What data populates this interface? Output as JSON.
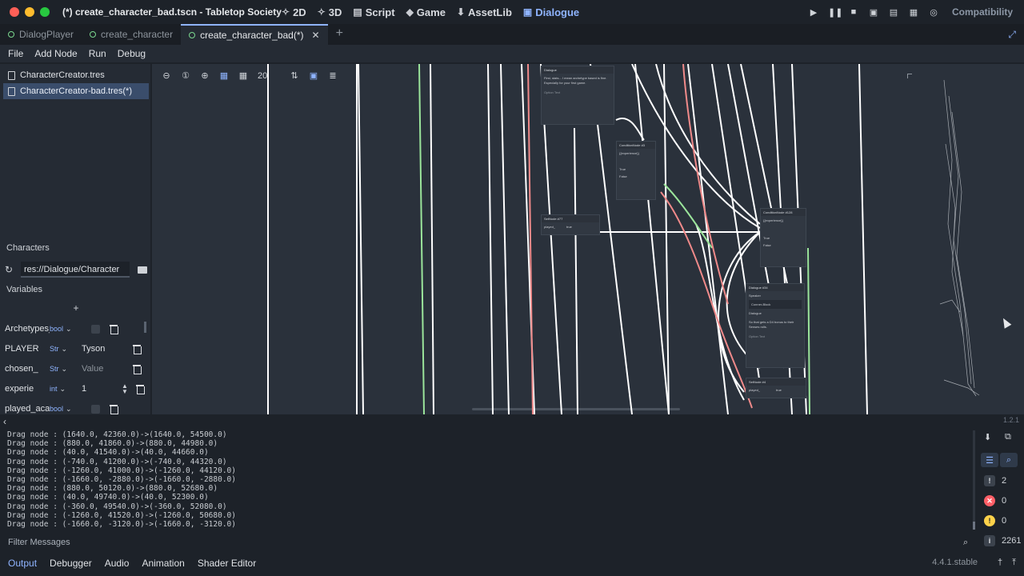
{
  "window": {
    "title": "(*) create_character_bad.tscn - Tabletop Society",
    "renderer": "Compatibility"
  },
  "main_modes": [
    {
      "label": "2D",
      "icon": "2d-icon"
    },
    {
      "label": "3D",
      "icon": "3d-icon"
    },
    {
      "label": "Script",
      "icon": "script-icon"
    },
    {
      "label": "Game",
      "icon": "game-icon"
    },
    {
      "label": "AssetLib",
      "icon": "assetlib-icon"
    },
    {
      "label": "Dialogue",
      "icon": "dialogue-icon",
      "active": true
    }
  ],
  "scene_tabs": [
    {
      "label": "DialogPlayer"
    },
    {
      "label": "create_character"
    },
    {
      "label": "create_character_bad(*)",
      "active": true
    }
  ],
  "menu": [
    "File",
    "Add Node",
    "Run",
    "Debug"
  ],
  "files": [
    {
      "label": "CharacterCreator.tres"
    },
    {
      "label": "CharacterCreator-bad.tres(*)",
      "selected": true
    }
  ],
  "characters": {
    "section_label": "Characters",
    "path": "res://Dialogue/Character"
  },
  "variables": {
    "section_label": "Variables",
    "add_label": "+",
    "rows": [
      {
        "name": "Archetypes_det",
        "type": "bool",
        "value": ""
      },
      {
        "name": "PLAYER",
        "type": "Str",
        "value": "Tyson"
      },
      {
        "name": "chosen_",
        "type": "Str",
        "value": "",
        "placeholder": "Value"
      },
      {
        "name": "experie",
        "type": "int",
        "value": "1"
      },
      {
        "name": "played_academ",
        "type": "bool",
        "value": ""
      }
    ]
  },
  "graph": {
    "zoom": "20",
    "nodes": [
      {
        "title": "Dialogue",
        "text": "First, stats... I mean archetype based is fine. Especially for your first game.",
        "footer": "Option Text"
      },
      {
        "title": "ConditionNode #3",
        "text": "{{experience}}",
        "a": "True",
        "b": "False"
      },
      {
        "title": "SetNode #77",
        "text": "played_",
        "value": "true"
      },
      {
        "title": "ConditionNode #128",
        "text": "{{experience}}",
        "a": "True",
        "b": "False"
      },
      {
        "title": "Dialogue #34",
        "speaker": "Speaker",
        "speaker_value": "Conner-Block",
        "dialogue": "Dialogue",
        "text": "So that gets a D4 bonus to their Senses rolls.",
        "footer": "Option Text"
      },
      {
        "title": "SetNode #4",
        "text": "played_",
        "value": "true"
      }
    ],
    "plugin_version": "1.2.1"
  },
  "output_lines": [
    "Drag node : (1640.0, 42360.0)->(1640.0, 54500.0)",
    "Drag node : (880.0, 41860.0)->(880.0, 44980.0)",
    "Drag node : (40.0, 41540.0)->(40.0, 44660.0)",
    "Drag node : (-740.0, 41200.0)->(-740.0, 44320.0)",
    "Drag node : (-1260.0, 41000.0)->(-1260.0, 44120.0)",
    "Drag node : (-1660.0, -2880.0)->(-1660.0, -2880.0)",
    "Drag node : (880.0, 50120.0)->(880.0, 52680.0)",
    "Drag node : (40.0, 49740.0)->(40.0, 52300.0)",
    "Drag node : (-360.0, 49540.0)->(-360.0, 52080.0)",
    "Drag node : (-1260.0, 41520.0)->(-1260.0, 50680.0)",
    "Drag node : (-1660.0, -3120.0)->(-1660.0, -3120.0)"
  ],
  "output_counts": {
    "messages": "2",
    "errors": "0",
    "warnings": "0",
    "total": "2261"
  },
  "filter_placeholder": "Filter Messages",
  "bottom_tabs": [
    {
      "label": "Output",
      "active": true
    },
    {
      "label": "Debugger"
    },
    {
      "label": "Audio"
    },
    {
      "label": "Animation"
    },
    {
      "label": "Shader Editor"
    }
  ],
  "engine_version": "4.4.1.stable",
  "colors": {
    "accent": "#8fb4ff",
    "error": "#ff5f67",
    "warning": "#ffd24a",
    "connection": "#ffffff",
    "connection_true": "#9be59b",
    "connection_false": "#f08a8a"
  }
}
